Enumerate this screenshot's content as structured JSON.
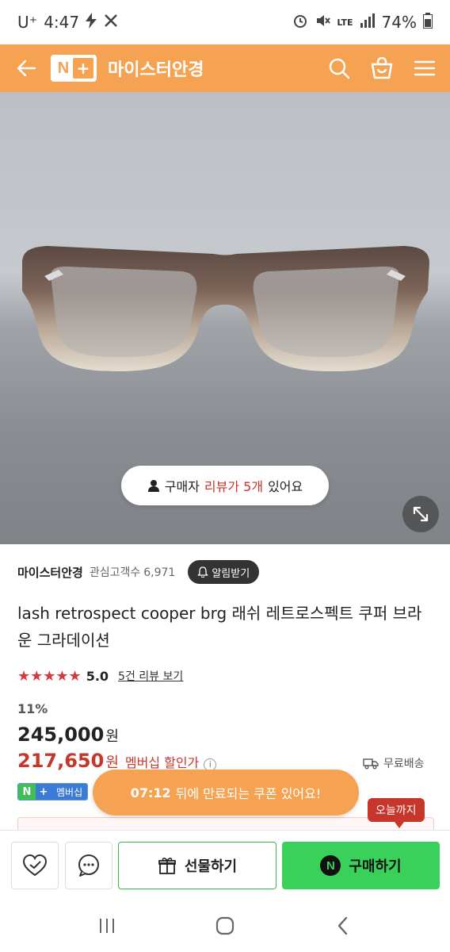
{
  "status_bar": {
    "carrier": "U⁺",
    "time": "4:47",
    "network": "LTE",
    "battery": "74%"
  },
  "header": {
    "logo_n": "N",
    "logo_plus": "+",
    "title": "마이스터안경"
  },
  "hero": {
    "review_prefix": "구매자",
    "review_highlight": "리뷰가 5개",
    "review_suffix": "있어요",
    "slide_count": 10,
    "active_slide": 0
  },
  "store": {
    "name": "마이스터안경",
    "fans_label": "관심고객수",
    "fans_count": "6,971",
    "notify_label": "알림받기"
  },
  "product": {
    "title": "lash retrospect cooper brg 래쉬 레트로스펙트 쿠퍼 브라운 그라데이션",
    "stars": "★★★★★",
    "rating": "5.0",
    "review_link": "5건 리뷰 보기",
    "discount": "11%",
    "original_price": "245,000",
    "won": "원",
    "member_price": "217,650",
    "member_label": "멤버십 할인가",
    "info_icon": "i",
    "shipping": "무료배송",
    "member_badge_n": "N",
    "member_badge_plus": "+",
    "member_badge_text": "멤버십"
  },
  "coupon": {
    "timer": "07:12",
    "message": "뒤에 만료되는 쿠폰 있어요!",
    "today_tag": "오늘까지"
  },
  "actions": {
    "gift_label": "선물하기",
    "buy_label": "구매하기",
    "npay_letter": "N"
  },
  "colors": {
    "brand_orange": "#f5a352",
    "price_red": "#c7362a",
    "buy_green": "#39d15a",
    "gift_green": "#39b54a"
  }
}
